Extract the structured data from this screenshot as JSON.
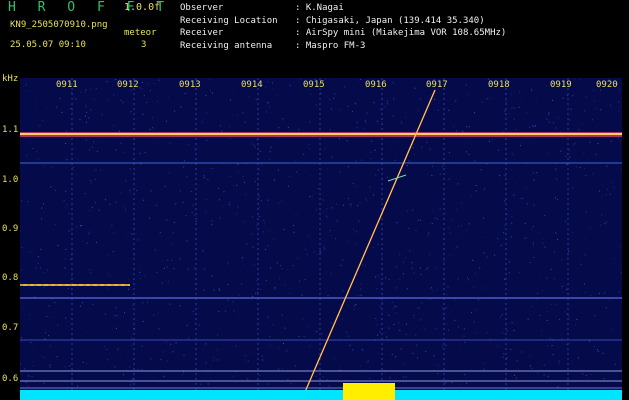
{
  "header": {
    "app_title": "H R O F F T",
    "version": "1.0.0f",
    "filename": "KN9_2505070910.png",
    "mode": "meteor",
    "timestamp": "25.05.07 09:10",
    "count": "3",
    "info": [
      {
        "key": "Observer",
        "value": ": K.Nagai"
      },
      {
        "key": "Receiving Location",
        "value": ": Chigasaki, Japan (139.414 35.340)"
      },
      {
        "key": "Receiver",
        "value": ": AirSpy mini (Miakejima VOR 108.65MHz)"
      },
      {
        "key": "Receiving antenna",
        "value": ": Maspro FM-3"
      }
    ]
  },
  "axis": {
    "unit": "kHz",
    "freq_labels": [
      "1.1",
      "1.0",
      "0.9",
      "0.8",
      "0.7",
      "0.6"
    ],
    "time_labels": [
      "0911",
      "0912",
      "0913",
      "0914",
      "0915",
      "0916",
      "0917",
      "0918",
      "0919",
      "0920"
    ]
  },
  "colors": {
    "label": "#e8e05a",
    "title": "#2cc26a",
    "floor": "#00e5ff",
    "burst": "#ffee00"
  }
}
